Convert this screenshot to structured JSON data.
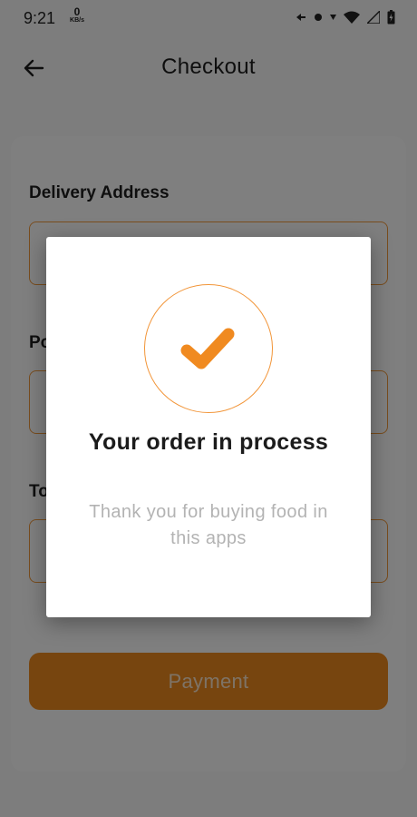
{
  "status_bar": {
    "time": "9:21",
    "net_speed": "0",
    "net_unit": "KB/s"
  },
  "header": {
    "back_icon": "arrow-left-icon",
    "title": "Checkout"
  },
  "form": {
    "delivery_label": "Delivery Address",
    "second_label_partial": "Po",
    "third_label_partial": "To"
  },
  "payment_button": {
    "label": "Payment"
  },
  "dialog": {
    "icon": "checkmark-icon",
    "title": "Your order in process",
    "message": "Thank you for buying food in this apps"
  },
  "colors": {
    "accent": "#f08a20",
    "accent_border": "#f39a3c",
    "overlay": "rgba(0,0,0,0.5)"
  }
}
